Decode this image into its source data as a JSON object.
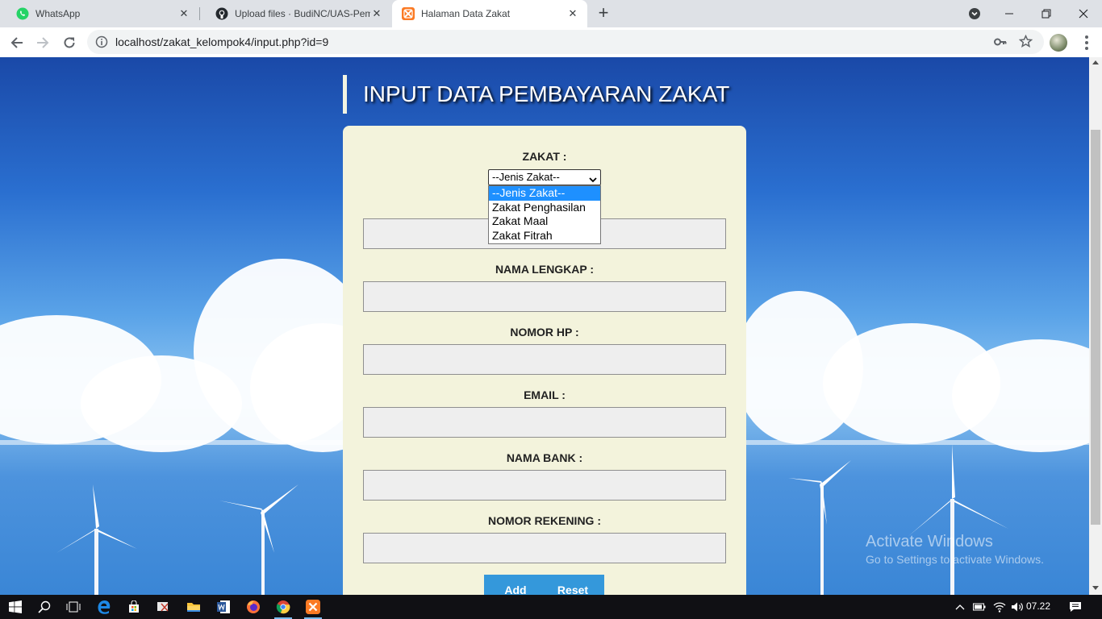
{
  "browser": {
    "tabs": [
      {
        "label": "WhatsApp",
        "icon": "whatsapp-icon"
      },
      {
        "label": "Upload files · BudiNC/UAS-Pemrog",
        "icon": "github-icon"
      },
      {
        "label": "Halaman Data Zakat",
        "icon": "xampp-icon",
        "active": true
      }
    ],
    "url": "localhost/zakat_kelompok4/input.php?id=9"
  },
  "page": {
    "title": "INPUT DATA PEMBAYARAN ZAKAT",
    "form": {
      "zakat_label": "ZAKAT :",
      "zakat_select_value": "--Jenis Zakat--",
      "zakat_options": [
        "--Jenis Zakat--",
        "Zakat Penghasilan",
        "Zakat Maal",
        "Zakat Fitrah"
      ],
      "nama_lengkap_label": "NAMA LENGKAP :",
      "nomor_hp_label": "NOMOR HP :",
      "email_label": "EMAIL :",
      "nama_bank_label": "NAMA BANK :",
      "nomor_rekening_label": "NOMOR REKENING :",
      "add_label": "Add",
      "reset_label": "Reset"
    }
  },
  "watermark": {
    "title": "Activate Windows",
    "subtitle": "Go to Settings to activate Windows."
  },
  "taskbar": {
    "clock": "07.22"
  },
  "colors": {
    "form_bg": "#f3f3dc",
    "button": "#3498db",
    "dropdown_highlight": "#1e90ff"
  }
}
